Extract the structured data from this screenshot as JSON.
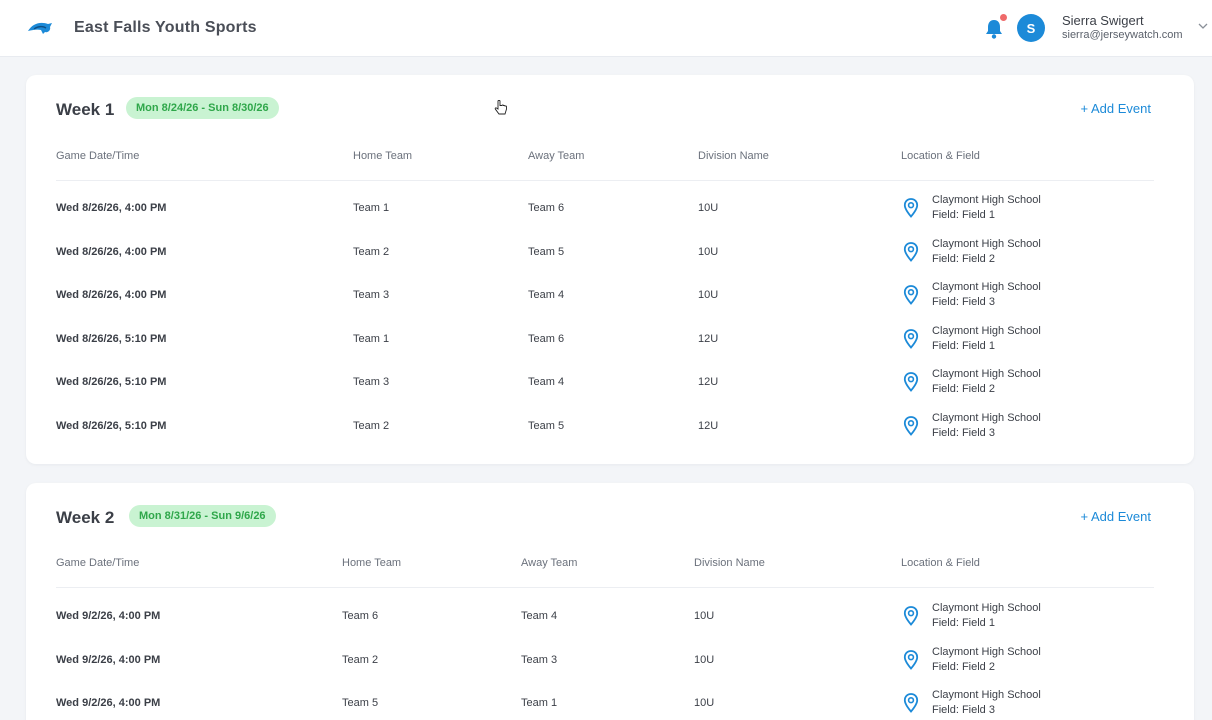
{
  "header": {
    "org_name": "East Falls Youth Sports",
    "user": {
      "name": "Sierra Swigert",
      "email": "sierra@jerseywatch.com",
      "initial": "S"
    }
  },
  "colors": {
    "accent": "#1c8ad8",
    "badge_bg": "#c9f3d2",
    "badge_text": "#2fa74a",
    "notification_dot": "#ef6a6a"
  },
  "columns": [
    "Game Date/Time",
    "Home Team",
    "Away Team",
    "Division Name",
    "Location & Field"
  ],
  "add_event_label": "+ Add Event",
  "weeks": [
    {
      "title": "Week 1",
      "range": "Mon 8/24/26 - Sun 8/30/26",
      "games": [
        {
          "datetime": "Wed 8/26/26, 4:00 PM",
          "home": "Team 1",
          "away": "Team 6",
          "division": "10U",
          "location": "Claymont High School",
          "field": "Field: Field 1"
        },
        {
          "datetime": "Wed 8/26/26, 4:00 PM",
          "home": "Team 2",
          "away": "Team 5",
          "division": "10U",
          "location": "Claymont High School",
          "field": "Field: Field 2"
        },
        {
          "datetime": "Wed 8/26/26, 4:00 PM",
          "home": "Team 3",
          "away": "Team 4",
          "division": "10U",
          "location": "Claymont High School",
          "field": "Field: Field 3"
        },
        {
          "datetime": "Wed 8/26/26, 5:10 PM",
          "home": "Team 1",
          "away": "Team 6",
          "division": "12U",
          "location": "Claymont High School",
          "field": "Field: Field 1"
        },
        {
          "datetime": "Wed 8/26/26, 5:10 PM",
          "home": "Team 3",
          "away": "Team 4",
          "division": "12U",
          "location": "Claymont High School",
          "field": "Field: Field 2"
        },
        {
          "datetime": "Wed 8/26/26, 5:10 PM",
          "home": "Team 2",
          "away": "Team 5",
          "division": "12U",
          "location": "Claymont High School",
          "field": "Field: Field 3"
        }
      ]
    },
    {
      "title": "Week 2",
      "range": "Mon 8/31/26 - Sun 9/6/26",
      "games": [
        {
          "datetime": "Wed 9/2/26, 4:00 PM",
          "home": "Team 6",
          "away": "Team 4",
          "division": "10U",
          "location": "Claymont High School",
          "field": "Field: Field 1"
        },
        {
          "datetime": "Wed 9/2/26, 4:00 PM",
          "home": "Team 2",
          "away": "Team 3",
          "division": "10U",
          "location": "Claymont High School",
          "field": "Field: Field 2"
        },
        {
          "datetime": "Wed 9/2/26, 4:00 PM",
          "home": "Team 5",
          "away": "Team 1",
          "division": "10U",
          "location": "Claymont High School",
          "field": "Field: Field 3"
        }
      ]
    }
  ]
}
